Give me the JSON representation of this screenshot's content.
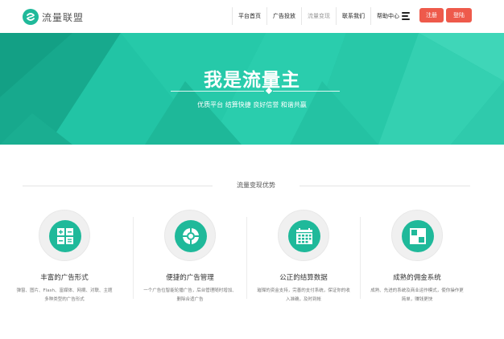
{
  "brand": {
    "name": "流量联盟",
    "color": "#1fb99a",
    "icon": "logo-swirl-icon"
  },
  "nav": {
    "items": [
      {
        "label": "平台首页",
        "active": false
      },
      {
        "label": "广告投放",
        "active": false
      },
      {
        "label": "流量变现",
        "active": true
      },
      {
        "label": "联系我们",
        "active": false
      },
      {
        "label": "帮助中心",
        "active": false
      }
    ],
    "menu_icon": "menu-icon",
    "register_label": "注册",
    "login_label": "登陆",
    "button_color": "#ee5a4b"
  },
  "hero": {
    "title": "我是流量主",
    "subtitle": "优质平台 结算快捷 良好信誉 和谐共赢",
    "background": "#21c0a2"
  },
  "section": {
    "title": "流量变现优势",
    "features": [
      {
        "title": "丰富的广告形式",
        "desc": "弹窗、图片、Flash、富媒体、网摘、对联、主题多种类型的广告形式",
        "icon": "calculator-icon"
      },
      {
        "title": "便捷的广告管理",
        "desc": "一个广告位智能轮播广告，后台管理随时增加、删除合适广告",
        "icon": "lifebuoy-icon"
      },
      {
        "title": "公正的结算数据",
        "desc": "璀璨的资金支持，完善的支付系统，保证你的收入准确，及时到帐",
        "icon": "calendar-icon"
      },
      {
        "title": "成熟的佣金系统",
        "desc": "成熟、先进的系统及商业运作模式，使你操作更简单，赚钱更快",
        "icon": "layout-blocks-icon"
      }
    ]
  }
}
